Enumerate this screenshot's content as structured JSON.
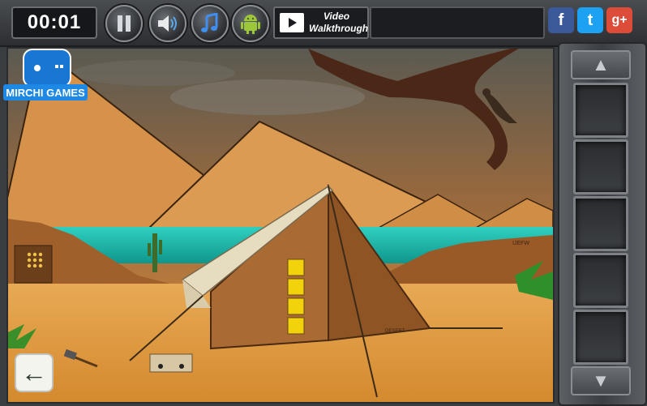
{
  "header": {
    "timer": "00:01",
    "video_walkthrough": {
      "line1": "Video",
      "line2": "Walkthrough"
    },
    "social": {
      "facebook": "f",
      "twitter": "t",
      "googleplus": "g+"
    }
  },
  "logo": {
    "text": "MIRCHI GAMES"
  },
  "scene": {
    "tent_sign": "DESERT",
    "right_wall_code": "IJEFW"
  },
  "colors": {
    "facebook": "#3b5998",
    "twitter": "#1da1f2",
    "googleplus": "#dd4b39",
    "sea": "#1fb5a8",
    "sand": "#e7a44a"
  },
  "inventory": {
    "slots": 5
  }
}
